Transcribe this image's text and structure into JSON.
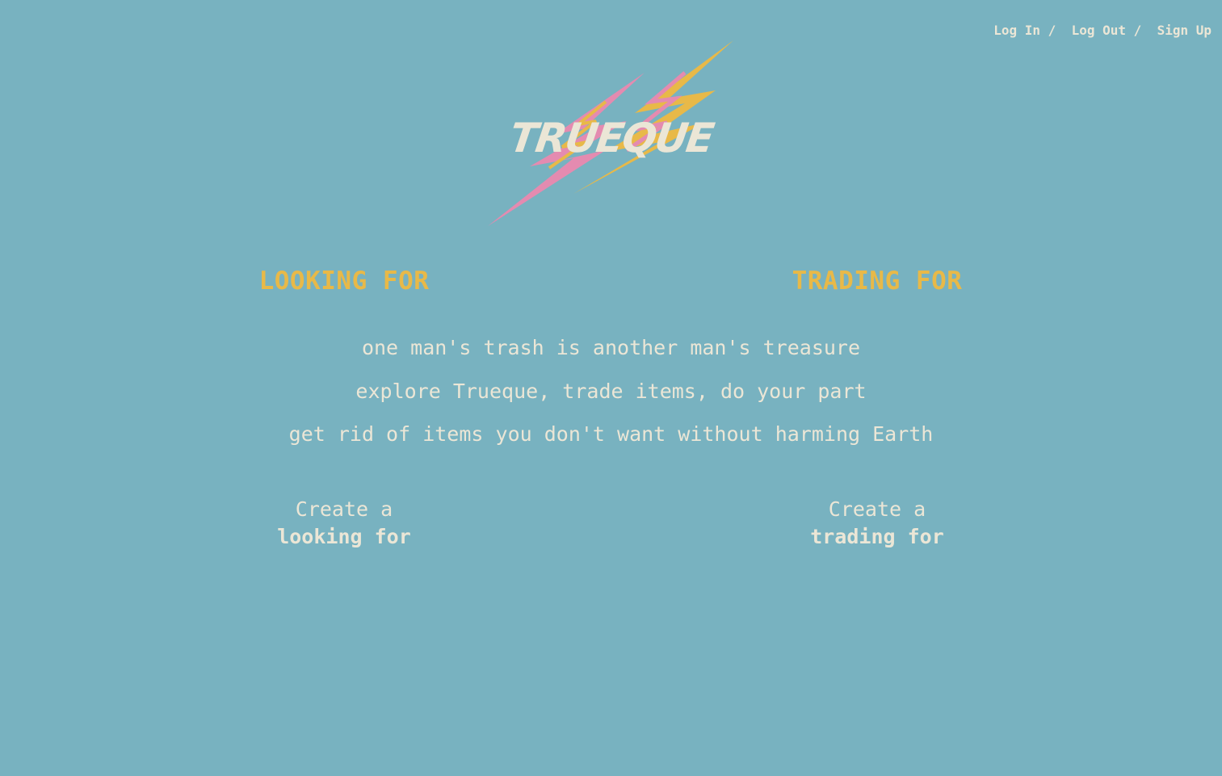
{
  "nav": {
    "login": "Log In",
    "logout": "Log Out",
    "signup": "Sign Up",
    "separator": "/"
  },
  "logo": {
    "text": "TRUEQUE",
    "colors": {
      "pink": "#e48bb0",
      "yellow": "#e8b948",
      "text": "#ebe6d6"
    }
  },
  "columns": {
    "left_heading": "LOOKING FOR",
    "right_heading": "TRADING FOR"
  },
  "taglines": {
    "line1": "one man's trash is another man's treasure",
    "line2": "explore Trueque, trade items, do your part",
    "line3": "get rid of items you don't want without harming Earth"
  },
  "create": {
    "left_prefix": "Create a",
    "left_strong": "looking for",
    "right_prefix": "Create a",
    "right_strong": "trading for"
  },
  "theme": {
    "background": "#78b2c0",
    "accent": "#e8b948",
    "text": "#ebe6d6"
  }
}
